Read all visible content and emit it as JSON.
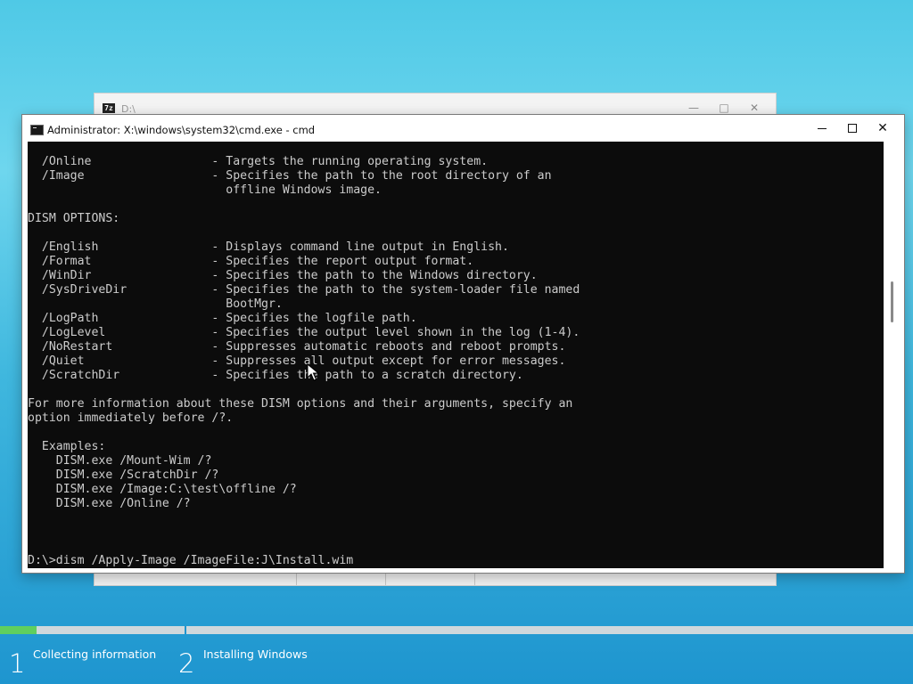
{
  "back_window": {
    "icon_text": "7z",
    "title": "D:\\"
  },
  "cmd_window": {
    "title": "Administrator: X:\\windows\\system32\\cmd.exe - cmd",
    "controls": [
      "minimize",
      "maximize",
      "close"
    ]
  },
  "console": {
    "lines": [
      "  /Online                 - Targets the running operating system.",
      "  /Image                  - Specifies the path to the root directory of an",
      "                            offline Windows image.",
      "",
      "DISM OPTIONS:",
      "",
      "  /English                - Displays command line output in English.",
      "  /Format                 - Specifies the report output format.",
      "  /WinDir                 - Specifies the path to the Windows directory.",
      "  /SysDriveDir            - Specifies the path to the system-loader file named",
      "                            BootMgr.",
      "  /LogPath                - Specifies the logfile path.",
      "  /LogLevel               - Specifies the output level shown in the log (1-4).",
      "  /NoRestart              - Suppresses automatic reboots and reboot prompts.",
      "  /Quiet                  - Suppresses all output except for error messages.",
      "  /ScratchDir             - Specifies the path to a scratch directory.",
      "",
      "For more information about these DISM options and their arguments, specify an",
      "option immediately before /?.",
      "",
      "  Examples:",
      "    DISM.exe /Mount-Wim /?",
      "    DISM.exe /ScratchDir /?",
      "    DISM.exe /Image:C:\\test\\offline /?",
      "    DISM.exe /Online /?"
    ],
    "prompt_line": "D:\\>dism /Apply-Image /ImageFile:J\\Install.wim"
  },
  "setup": {
    "progress": 0.04,
    "steps": [
      {
        "number": "1",
        "label": "Collecting information"
      },
      {
        "number": "2",
        "label": "Installing Windows"
      }
    ]
  },
  "colors": {
    "console_bg": "#0c0c0c",
    "console_text": "#cccccc",
    "progress_fill": "#5fcf5f"
  }
}
